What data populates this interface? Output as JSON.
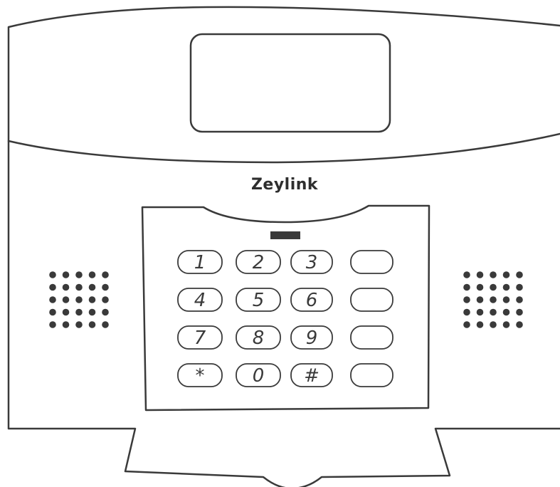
{
  "brand": "Zeylink",
  "keypad": {
    "rows": [
      [
        "1",
        "2",
        "3",
        ""
      ],
      [
        "4",
        "5",
        "6",
        ""
      ],
      [
        "7",
        "8",
        "9",
        ""
      ],
      [
        "*",
        "0",
        "#",
        ""
      ]
    ]
  },
  "colors": {
    "outline": "#3a3a3a",
    "background": "#ffffff",
    "indicator": "#3a3a3a"
  },
  "icons": {
    "left_speaker": "speaker-grille-icon",
    "right_speaker": "speaker-grille-icon"
  }
}
